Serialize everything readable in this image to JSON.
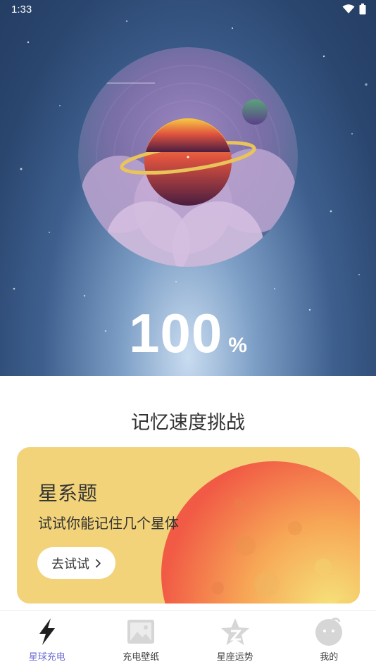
{
  "status_bar": {
    "time": "1:33"
  },
  "charge": {
    "value": "100",
    "unit": "%"
  },
  "section": {
    "title": "记忆速度挑战"
  },
  "card": {
    "title": "星系题",
    "subtitle": "试试你能记住几个星体",
    "button_label": "去试试",
    "background_color": "#f2d37a"
  },
  "tabbar": {
    "active_color": "#6b6bd6",
    "items": [
      {
        "label": "星球充电",
        "icon": "lightning-bolt-icon",
        "active": true
      },
      {
        "label": "充电壁纸",
        "icon": "image-icon",
        "active": false
      },
      {
        "label": "星座运势",
        "icon": "star-icon",
        "active": false
      },
      {
        "label": "我的",
        "icon": "profile-face-icon",
        "active": false
      }
    ]
  }
}
